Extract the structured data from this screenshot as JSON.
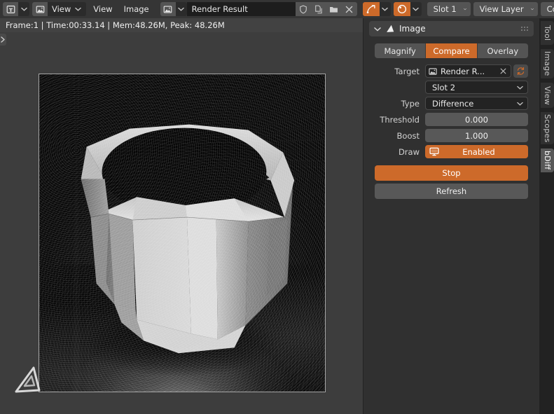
{
  "app": {
    "title": "Blender Image Editor",
    "accent_color": "#cd6a2a",
    "panel_bg": "#303030",
    "header_bg": "#353535"
  },
  "topbar": {
    "editor_type_icon": "image-editor-icon",
    "view_mode_icon": "image-view-icon",
    "view_mode_label": "View",
    "menus": [
      {
        "label": "View",
        "name": "menu-view"
      },
      {
        "label": "Image",
        "name": "menu-image"
      }
    ],
    "datablock": {
      "browse_icon": "browse-image-icon",
      "name": "Render Result",
      "fake_user_icon": "shield-icon",
      "copy_icon": "copy-icon",
      "open_icon": "folder-open-icon",
      "unlink_icon": "close-icon"
    },
    "toggles": [
      {
        "name": "snap-toggle",
        "icon": "snap-curve-icon"
      },
      {
        "name": "color-management-toggle",
        "icon": "gamma-sphere-icon"
      }
    ],
    "selectors": [
      {
        "name": "render-slot-select",
        "label": "Slot 1"
      },
      {
        "name": "view-layer-select",
        "label": "View Layer"
      },
      {
        "name": "render-pass-select",
        "label": "Combined"
      }
    ]
  },
  "status": {
    "text": "Frame:1 | Time:00:33.14 | Mem:48.26M, Peak: 48.26M",
    "frame": "1",
    "time": "00:33.14",
    "mem": "48.26M",
    "peak": "48.26M"
  },
  "canvas": {
    "logo_icon": "blender-cone-logo-icon",
    "region_toggle_icon": "chevron-right-icon",
    "image_alt": "Grayscale render of a faceted cylindrical cup on a floor with soft shadow"
  },
  "panel": {
    "header": {
      "collapse_icon": "chevron-down-icon",
      "icon": "cone-icon",
      "title": "Image",
      "grip_icon": "grip-dots-icon"
    },
    "tabs": [
      {
        "label": "Magnify",
        "name": "tab-magnify",
        "active": false
      },
      {
        "label": "Compare",
        "name": "tab-compare",
        "active": true
      },
      {
        "label": "Overlay",
        "name": "tab-overlay",
        "active": false
      }
    ],
    "rows": {
      "target": {
        "label": "Target",
        "icon": "image-datablock-icon",
        "value": "Render R...",
        "clear_icon": "close-icon",
        "refresh_icon": "refresh-icon"
      },
      "slot": {
        "label": "",
        "value": "Slot 2",
        "chevron": "chevron-down-icon"
      },
      "type": {
        "label": "Type",
        "value": "Difference",
        "chevron": "chevron-down-icon"
      },
      "threshold": {
        "label": "Threshold",
        "value": "0.000"
      },
      "boost": {
        "label": "Boost",
        "value": "1.000"
      },
      "draw": {
        "label": "Draw",
        "value": "Enabled",
        "icon": "monitor-icon",
        "enabled": true
      }
    },
    "buttons": {
      "stop": "Stop",
      "refresh": "Refresh"
    }
  },
  "vtabs": [
    {
      "label": "Tool",
      "name": "vtab-tool",
      "active": false
    },
    {
      "label": "Image",
      "name": "vtab-image",
      "active": false
    },
    {
      "label": "View",
      "name": "vtab-view",
      "active": false
    },
    {
      "label": "Scopes",
      "name": "vtab-scopes",
      "active": false
    },
    {
      "label": "bDiff",
      "name": "vtab-bdiff",
      "active": true
    }
  ]
}
